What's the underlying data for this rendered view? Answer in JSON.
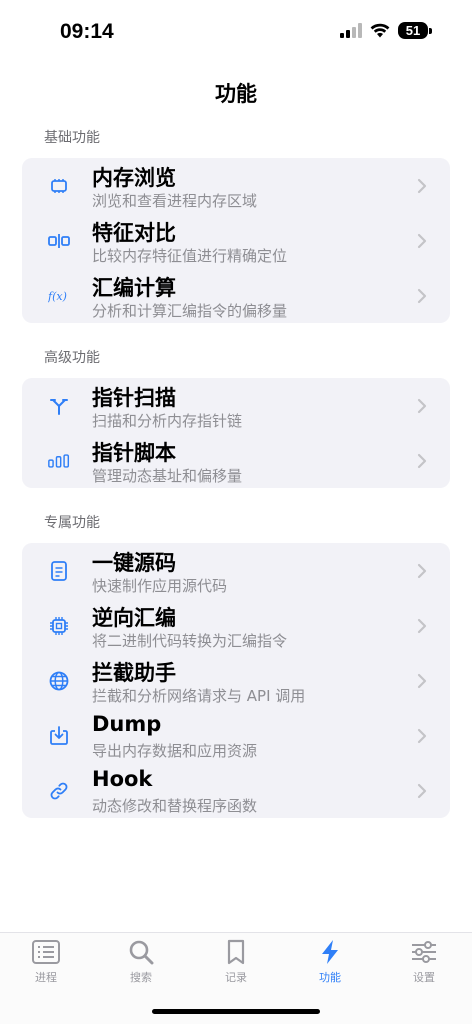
{
  "status": {
    "time": "09:14",
    "battery": "51"
  },
  "header": {
    "title": "功能"
  },
  "colors": {
    "accent": "#2f7ff7",
    "icon": "#2f7ff7",
    "card_bg": "#f2f2f7",
    "section_label": "#6d6d72",
    "subtitle": "#8e8e93",
    "inactive_tab": "#9a9aa0"
  },
  "sections": [
    {
      "label": "基础功能",
      "items": [
        {
          "icon": "memory-chip-icon",
          "title": "内存浏览",
          "subtitle": "浏览和查看进程内存区域"
        },
        {
          "icon": "compare-icon",
          "title": "特征对比",
          "subtitle": "比较内存特征值进行精确定位"
        },
        {
          "icon": "function-icon",
          "title": "汇编计算",
          "subtitle": "分析和计算汇编指令的偏移量"
        }
      ]
    },
    {
      "label": "高级功能",
      "items": [
        {
          "icon": "pointer-branch-icon",
          "title": "指针扫描",
          "subtitle": "扫描和分析内存指针链"
        },
        {
          "icon": "script-bars-icon",
          "title": "指针脚本",
          "subtitle": "管理动态基址和偏移量"
        }
      ]
    },
    {
      "label": "专属功能",
      "items": [
        {
          "icon": "document-icon",
          "title": "一键源码",
          "subtitle": "快速制作应用源代码"
        },
        {
          "icon": "cpu-icon",
          "title": "逆向汇编",
          "subtitle": "将二进制代码转换为汇编指令"
        },
        {
          "icon": "globe-icon",
          "title": "拦截助手",
          "subtitle": "拦截和分析网络请求与 API 调用"
        },
        {
          "icon": "download-icon",
          "title": "Dump",
          "subtitle": "导出内存数据和应用资源"
        },
        {
          "icon": "link-icon",
          "title": "Hook",
          "subtitle": "动态修改和替换程序函数"
        }
      ]
    }
  ],
  "tabbar": {
    "tabs": [
      {
        "icon": "list-icon",
        "label": "进程",
        "active": false
      },
      {
        "icon": "search-icon",
        "label": "搜索",
        "active": false
      },
      {
        "icon": "bookmark-icon",
        "label": "记录",
        "active": false
      },
      {
        "icon": "bolt-icon",
        "label": "功能",
        "active": true
      },
      {
        "icon": "sliders-icon",
        "label": "设置",
        "active": false
      }
    ]
  }
}
